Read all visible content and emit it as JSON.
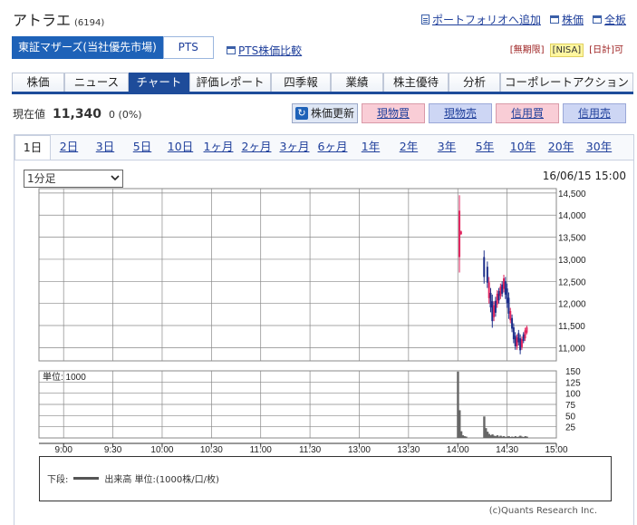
{
  "stock": {
    "name": "アトラエ",
    "code": "(6194)"
  },
  "top_links": [
    "ポートフォリオへ追加",
    "株価",
    "全板"
  ],
  "market": {
    "active_label": "東証マザーズ(当社優先市場)",
    "pts_label": "PTS",
    "pts_compare_link": "PTS株価比較"
  },
  "badges": [
    "[無期限]",
    "[NISA]",
    "[日計]可"
  ],
  "nav_tabs": [
    "株価",
    "ニュース",
    "チャート",
    "評価レポート",
    "四季報",
    "業績",
    "株主優待",
    "分析",
    "コーポレートアクション"
  ],
  "nav_active_index": 2,
  "price": {
    "label": "現在値",
    "value": "11,340",
    "change": "0 (0%)"
  },
  "actions": {
    "refresh": "株価更新",
    "spot_buy": "現物買",
    "spot_sell": "現物売",
    "margin_buy": "信用買",
    "margin_sell": "信用売"
  },
  "period_tabs": [
    "1日",
    "2日",
    "3日",
    "5日",
    "10日",
    "1ヶ月",
    "2ヶ月",
    "3ヶ月",
    "6ヶ月",
    "1年",
    "2年",
    "3年",
    "5年",
    "10年",
    "20年",
    "30年"
  ],
  "period_active_index": 0,
  "interval_select": {
    "value": "1分足"
  },
  "timestamp": "16/06/15 15:00",
  "chart_data": {
    "type": "candlestick",
    "price_axis": {
      "ticks": [
        "14,500",
        "14,000",
        "13,500",
        "13,000",
        "12,500",
        "12,000",
        "11,500",
        "11,000"
      ],
      "ylim": [
        10700,
        14600
      ]
    },
    "volume_axis": {
      "label": "単位: 1000",
      "ticks": [
        "150",
        "125",
        "100",
        "75",
        "50",
        "25"
      ],
      "ylim": [
        0,
        150
      ]
    },
    "time_axis": [
      "9:00",
      "9:30",
      "10:00",
      "10:30",
      "11:00",
      "11:30",
      "13:00",
      "13:30",
      "14:00",
      "14:30",
      "15:00"
    ],
    "price_candles": [
      {
        "t": "14:01",
        "high": 14450,
        "low": 12700,
        "up": true
      },
      {
        "t": "14:02",
        "high": 13650,
        "low": 13550,
        "up": true
      },
      {
        "t": "14:16",
        "high": 13200,
        "low": 12450,
        "up": false
      },
      {
        "t": "14:18",
        "high": 12950,
        "low": 12350,
        "up": false
      },
      {
        "t": "14:19",
        "high": 12600,
        "low": 12000,
        "up": true
      },
      {
        "t": "14:20",
        "high": 12350,
        "low": 11800,
        "up": false
      },
      {
        "t": "14:21",
        "high": 12200,
        "low": 11450,
        "up": false
      },
      {
        "t": "14:22",
        "high": 12050,
        "low": 11600,
        "up": true
      },
      {
        "t": "14:23",
        "high": 12150,
        "low": 11700,
        "up": false
      },
      {
        "t": "14:24",
        "high": 12300,
        "low": 11900,
        "up": true
      },
      {
        "t": "14:25",
        "high": 12350,
        "low": 12000,
        "up": false
      },
      {
        "t": "14:26",
        "high": 12450,
        "low": 12100,
        "up": true
      },
      {
        "t": "14:27",
        "high": 12500,
        "low": 12150,
        "up": false
      },
      {
        "t": "14:28",
        "high": 12650,
        "low": 12250,
        "up": true
      },
      {
        "t": "14:29",
        "high": 12600,
        "low": 12100,
        "up": false
      },
      {
        "t": "14:30",
        "high": 12450,
        "low": 11900,
        "up": false
      },
      {
        "t": "14:31",
        "high": 12250,
        "low": 11650,
        "up": false
      },
      {
        "t": "14:32",
        "high": 11900,
        "low": 11550,
        "up": true
      },
      {
        "t": "14:33",
        "high": 11750,
        "low": 11350,
        "up": false
      },
      {
        "t": "14:34",
        "high": 11550,
        "low": 11100,
        "up": false
      },
      {
        "t": "14:35",
        "high": 11350,
        "low": 10950,
        "up": false
      },
      {
        "t": "14:36",
        "high": 11300,
        "low": 10950,
        "up": true
      },
      {
        "t": "14:37",
        "high": 11400,
        "low": 11050,
        "up": false
      },
      {
        "t": "14:38",
        "high": 11300,
        "low": 10850,
        "up": false
      },
      {
        "t": "14:39",
        "high": 11250,
        "low": 10950,
        "up": true
      },
      {
        "t": "14:40",
        "high": 11350,
        "low": 11100,
        "up": false
      },
      {
        "t": "14:41",
        "high": 11450,
        "low": 11150,
        "up": true
      },
      {
        "t": "14:42",
        "high": 11500,
        "low": 11300,
        "up": true
      }
    ],
    "volume_bars": [
      {
        "t": "14:00",
        "v": 148
      },
      {
        "t": "14:01",
        "v": 62
      },
      {
        "t": "14:02",
        "v": 15
      },
      {
        "t": "14:03",
        "v": 6
      },
      {
        "t": "14:04",
        "v": 4
      },
      {
        "t": "14:05",
        "v": 3
      },
      {
        "t": "14:16",
        "v": 48
      },
      {
        "t": "14:17",
        "v": 22
      },
      {
        "t": "14:18",
        "v": 14
      },
      {
        "t": "14:19",
        "v": 9
      },
      {
        "t": "14:20",
        "v": 6
      },
      {
        "t": "14:21",
        "v": 8
      },
      {
        "t": "14:22",
        "v": 5
      },
      {
        "t": "14:23",
        "v": 4
      },
      {
        "t": "14:24",
        "v": 6
      },
      {
        "t": "14:25",
        "v": 3
      },
      {
        "t": "14:26",
        "v": 5
      },
      {
        "t": "14:27",
        "v": 3
      },
      {
        "t": "14:28",
        "v": 4
      },
      {
        "t": "14:29",
        "v": 2
      },
      {
        "t": "14:30",
        "v": 3
      },
      {
        "t": "14:31",
        "v": 4
      },
      {
        "t": "14:32",
        "v": 2
      },
      {
        "t": "14:33",
        "v": 3
      },
      {
        "t": "14:34",
        "v": 2
      },
      {
        "t": "14:35",
        "v": 4
      },
      {
        "t": "14:36",
        "v": 2
      },
      {
        "t": "14:37",
        "v": 3
      },
      {
        "t": "14:38",
        "v": 5
      },
      {
        "t": "14:39",
        "v": 3
      },
      {
        "t": "14:40",
        "v": 2
      },
      {
        "t": "14:41",
        "v": 4
      },
      {
        "t": "14:42",
        "v": 3
      }
    ],
    "colors": {
      "up": "#e0245e",
      "down": "#1e2f8a",
      "volume": "#666666",
      "grid": "#888888"
    }
  },
  "legend": {
    "prefix": "下段:",
    "text": "出来高 単位:(1000株/口/枚)"
  },
  "copyright": "(c)Quants Research Inc."
}
